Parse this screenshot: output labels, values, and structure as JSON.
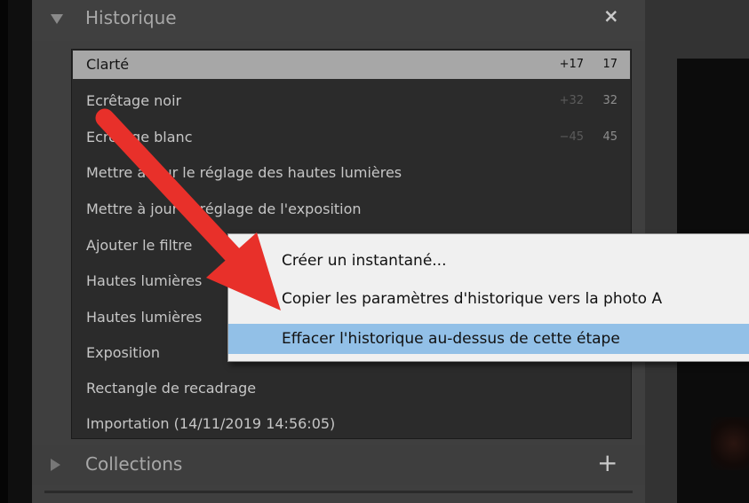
{
  "panel": {
    "title": "Historique",
    "close_glyph": "×",
    "collapse_icon": "triangle-down-icon"
  },
  "history": [
    {
      "label": "Clarté",
      "delta": "+17",
      "value": "17",
      "selected": true
    },
    {
      "label": "Ecrêtage noir",
      "delta": "+32",
      "value": "32"
    },
    {
      "label": "Ecrêtage blanc",
      "delta": "−45",
      "value": "45"
    },
    {
      "label": "Mettre à jour le réglage des hautes lumières"
    },
    {
      "label": "Mettre à jour le réglage de l'exposition"
    },
    {
      "label": "Ajouter le filtre"
    },
    {
      "label": "Hautes lumières"
    },
    {
      "label": "Hautes lumières"
    },
    {
      "label": "Exposition"
    },
    {
      "label": "Rectangle de recadrage"
    },
    {
      "label": "Importation (14/11/2019 14:56:05)"
    }
  ],
  "context_menu": [
    {
      "label": "Créer un instantané..."
    },
    {
      "label": "Copier les paramètres d'historique vers la photo A"
    },
    {
      "label": "Effacer l'historique au-dessus de cette étape",
      "highlighted": true
    }
  ],
  "collections": {
    "title": "Collections",
    "add_glyph": "+"
  },
  "colors": {
    "panel": "#3f3f3f",
    "list_bg": "#2b2b2b",
    "selected_row": "#a7a7a7",
    "menu_bg": "#f0f0f0",
    "menu_highlight": "#92c0e7",
    "arrow": "#e8302a"
  }
}
